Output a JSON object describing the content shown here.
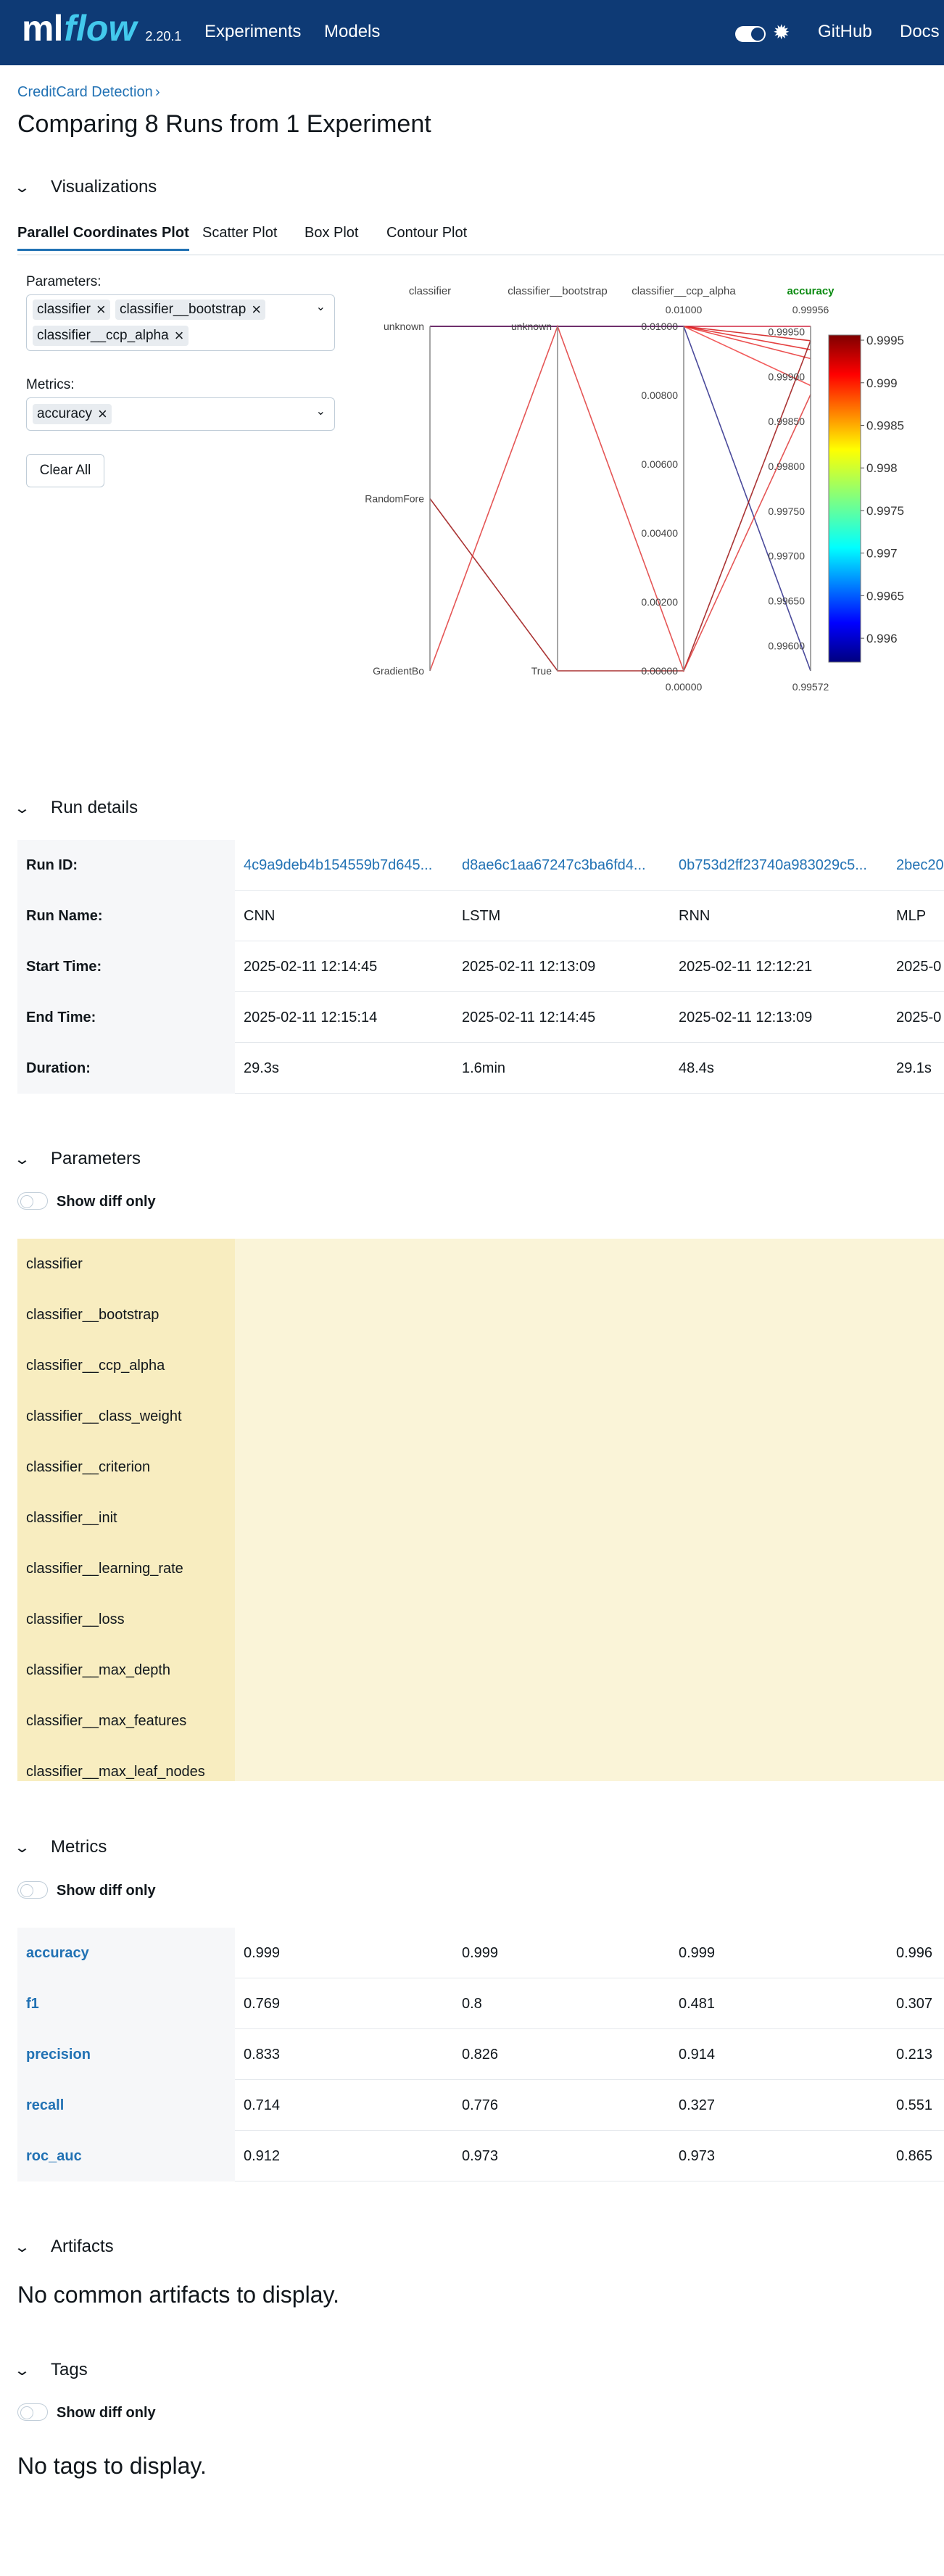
{
  "header": {
    "logo_ml": "ml",
    "logo_flow": "flow",
    "version": "2.20.1",
    "nav": [
      "Experiments",
      "Models"
    ],
    "right_links": [
      "GitHub",
      "Docs"
    ],
    "theme_toggle_icon": "toggle-icon",
    "sun_icon": "sun-icon"
  },
  "breadcrumb": {
    "label": "CreditCard Detection",
    "separator": "›"
  },
  "page_title": "Comparing 8 Runs from 1 Experiment",
  "sections": {
    "visualizations": "Visualizations",
    "run_details": "Run details",
    "parameters": "Parameters",
    "metrics": "Metrics",
    "artifacts": "Artifacts",
    "tags": "Tags"
  },
  "tabs": [
    "Parallel Coordinates Plot",
    "Scatter Plot",
    "Box Plot",
    "Contour Plot"
  ],
  "selectors": {
    "parameters_label": "Parameters:",
    "parameters_chips": [
      "classifier",
      "classifier__bootstrap",
      "classifier__ccp_alpha"
    ],
    "metrics_label": "Metrics:",
    "metrics_chips": [
      "accuracy"
    ],
    "clear_all": "Clear All"
  },
  "chart_data": {
    "type": "parallel_coordinates",
    "axes": [
      {
        "name": "classifier",
        "kind": "categorical",
        "ticks": [
          "unknown",
          "RandomFore",
          "GradientBo"
        ]
      },
      {
        "name": "classifier__bootstrap",
        "kind": "categorical",
        "ticks": [
          "unknown",
          "True"
        ]
      },
      {
        "name": "classifier__ccp_alpha",
        "kind": "numeric",
        "range": [
          0,
          0.01
        ],
        "ticks": [
          "0.01000",
          "0.00800",
          "0.00600",
          "0.00400",
          "0.00200",
          "0.00000"
        ],
        "min_label": "0.00000",
        "max_label": "0.01000"
      },
      {
        "name": "accuracy",
        "kind": "numeric",
        "range": [
          0.99572,
          0.99956
        ],
        "ticks": [
          "0.99950",
          "0.99900",
          "0.99850",
          "0.99800",
          "0.99750",
          "0.99700",
          "0.99650",
          "0.99600"
        ],
        "min_label": "0.99572",
        "max_label": "0.99956"
      }
    ],
    "colorbar": {
      "ticks": [
        "0.9995",
        "0.999",
        "0.9985",
        "0.998",
        "0.9975",
        "0.997",
        "0.9965",
        "0.996"
      ]
    },
    "lines": [
      {
        "classifier": "unknown",
        "bootstrap": "unknown",
        "ccp_alpha": 0.01,
        "accuracy": 0.99956,
        "color": "#c8001e"
      },
      {
        "classifier": "unknown",
        "bootstrap": "unknown",
        "ccp_alpha": 0.01,
        "accuracy": 0.9994,
        "color": "#d01010"
      },
      {
        "classifier": "unknown",
        "bootstrap": "unknown",
        "ccp_alpha": 0.01,
        "accuracy": 0.9993,
        "color": "#e02020"
      },
      {
        "classifier": "unknown",
        "bootstrap": "unknown",
        "ccp_alpha": 0.01,
        "accuracy": 0.9992,
        "color": "#e83030"
      },
      {
        "classifier": "unknown",
        "bootstrap": "unknown",
        "ccp_alpha": 0.01,
        "accuracy": 0.9989,
        "color": "#f04040"
      },
      {
        "classifier": "unknown",
        "bootstrap": "unknown",
        "ccp_alpha": 0.01,
        "accuracy": 0.99572,
        "color": "#2a2a8a"
      },
      {
        "classifier": "RandomFore",
        "bootstrap": "True",
        "ccp_alpha": 0.0,
        "accuracy": 0.9994,
        "color": "#9b1010"
      },
      {
        "classifier": "GradientBo",
        "bootstrap": "unknown",
        "ccp_alpha": 0.0,
        "accuracy": 0.9988,
        "color": "#e03838"
      }
    ]
  },
  "run_details": {
    "headers": [
      "Run ID:",
      "Run Name:",
      "Start Time:",
      "End Time:",
      "Duration:"
    ],
    "runs": [
      {
        "id": "4c9a9deb4b154559b7d645...",
        "name": "CNN",
        "start": "2025-02-11 12:14:45",
        "end": "2025-02-11 12:15:14",
        "duration": "29.3s"
      },
      {
        "id": "d8ae6c1aa67247c3ba6fd4...",
        "name": "LSTM",
        "start": "2025-02-11 12:13:09",
        "end": "2025-02-11 12:14:45",
        "duration": "1.6min"
      },
      {
        "id": "0b753d2ff23740a983029c5...",
        "name": "RNN",
        "start": "2025-02-11 12:12:21",
        "end": "2025-02-11 12:13:09",
        "duration": "48.4s"
      },
      {
        "id": "2bec20",
        "name": "MLP",
        "start": "2025-0",
        "end": "2025-0",
        "duration": "29.1s"
      }
    ]
  },
  "parameters": {
    "show_diff_only": "Show diff only",
    "rows": [
      "classifier",
      "classifier__bootstrap",
      "classifier__ccp_alpha",
      "classifier__class_weight",
      "classifier__criterion",
      "classifier__init",
      "classifier__learning_rate",
      "classifier__loss",
      "classifier__max_depth",
      "classifier__max_features",
      "classifier__max_leaf_nodes"
    ]
  },
  "metrics": {
    "show_diff_only": "Show diff only",
    "rows": [
      {
        "name": "accuracy",
        "values": [
          "0.999",
          "0.999",
          "0.999",
          "0.996"
        ]
      },
      {
        "name": "f1",
        "values": [
          "0.769",
          "0.8",
          "0.481",
          "0.307"
        ]
      },
      {
        "name": "precision",
        "values": [
          "0.833",
          "0.826",
          "0.914",
          "0.213"
        ]
      },
      {
        "name": "recall",
        "values": [
          "0.714",
          "0.776",
          "0.327",
          "0.551"
        ]
      },
      {
        "name": "roc_auc",
        "values": [
          "0.912",
          "0.973",
          "0.973",
          "0.865"
        ]
      }
    ]
  },
  "artifacts": {
    "empty": "No common artifacts to display."
  },
  "tags": {
    "show_diff_only": "Show diff only",
    "empty": "No tags to display."
  }
}
